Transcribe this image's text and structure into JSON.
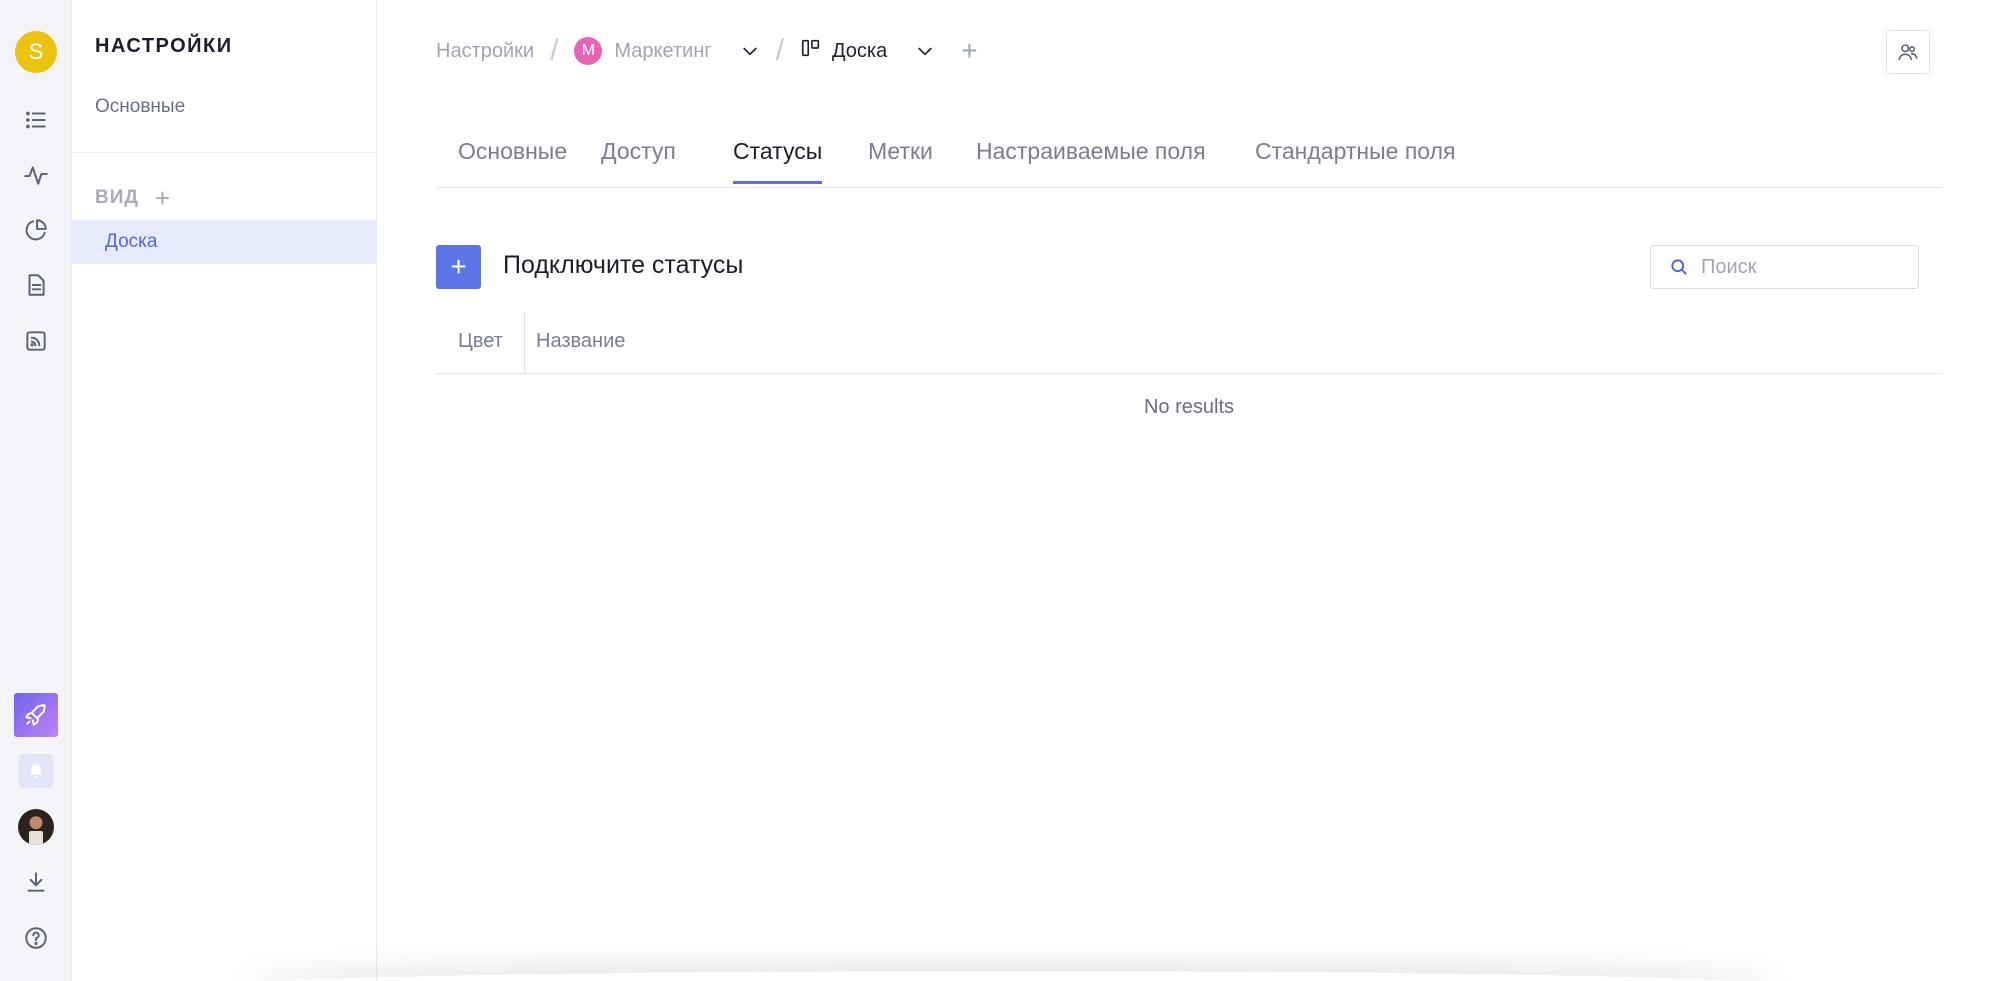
{
  "rail": {
    "workspace_initial": "S",
    "icons": [
      "list-icon",
      "activity-icon",
      "pie-chart-icon",
      "document-icon",
      "rss-icon",
      "rocket-icon",
      "bell-icon",
      "download-icon",
      "help-icon"
    ],
    "accent_gradient": [
      "#6f63ee",
      "#c083f2"
    ],
    "workspace_color": "#ecc40f"
  },
  "sidebar": {
    "title": "НАСТРОЙКИ",
    "general_item": "Основные",
    "section_label": "ВИД",
    "section_add": "+",
    "active_item": "Доска"
  },
  "breadcrumb": {
    "root": "Настройки",
    "space_initial": "М",
    "space": "Маркетинг",
    "view": "Доска",
    "add": "+",
    "space_color": "#e664b8"
  },
  "tabs": [
    {
      "label": "Основные"
    },
    {
      "label": "Доступ"
    },
    {
      "label": "Статусы",
      "active": true
    },
    {
      "label": "Метки"
    },
    {
      "label": "Настраиваемые поля"
    },
    {
      "label": "Стандартные поля"
    }
  ],
  "statuses": {
    "add_label": "+",
    "title": "Подключите статусы",
    "search_placeholder": "Поиск",
    "columns": [
      "Цвет",
      "Название"
    ],
    "empty_text": "No results"
  },
  "colors": {
    "accent": "#5b74e6",
    "active_bg": "#e7eafb"
  }
}
